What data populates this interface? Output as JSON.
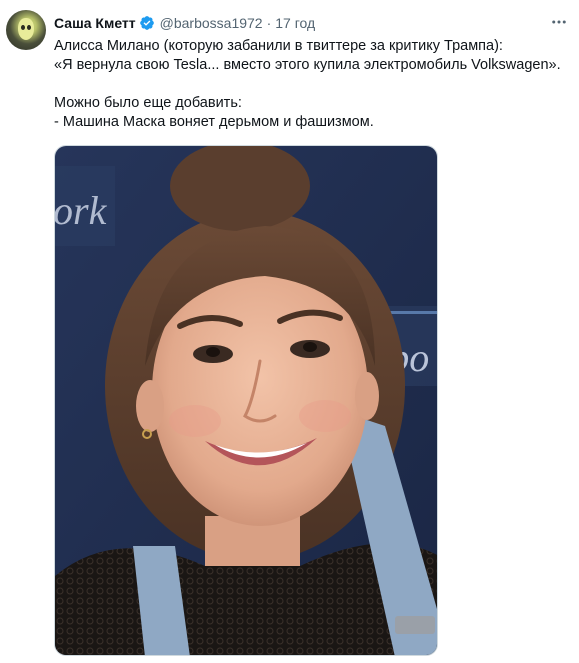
{
  "author": {
    "name": "Саша Кметт",
    "handle": "@barbossa1972",
    "separator": "·",
    "time": "17 год",
    "verified": true
  },
  "icons": {
    "more": "more-horizontal-icon",
    "verified": "verified-badge-icon"
  },
  "tweet": {
    "lines": [
      "Алисса Милано (которую забанили в твиттере за критику Трампа):",
      "«Я вернула свою Tesla... вместо этого купила электромобиль Volkswagen».",
      "",
      "Можно было еще добавить:",
      "- Машина Маска воняет дерьмом и фашизмом."
    ]
  },
  "media": {
    "backdrop_text_left": "ork",
    "backdrop_text_right": "Expo"
  },
  "colors": {
    "text": "#0f1419",
    "secondary": "#536471",
    "verified": "#1d9bf0",
    "backdrop": "#1e2c4f"
  }
}
